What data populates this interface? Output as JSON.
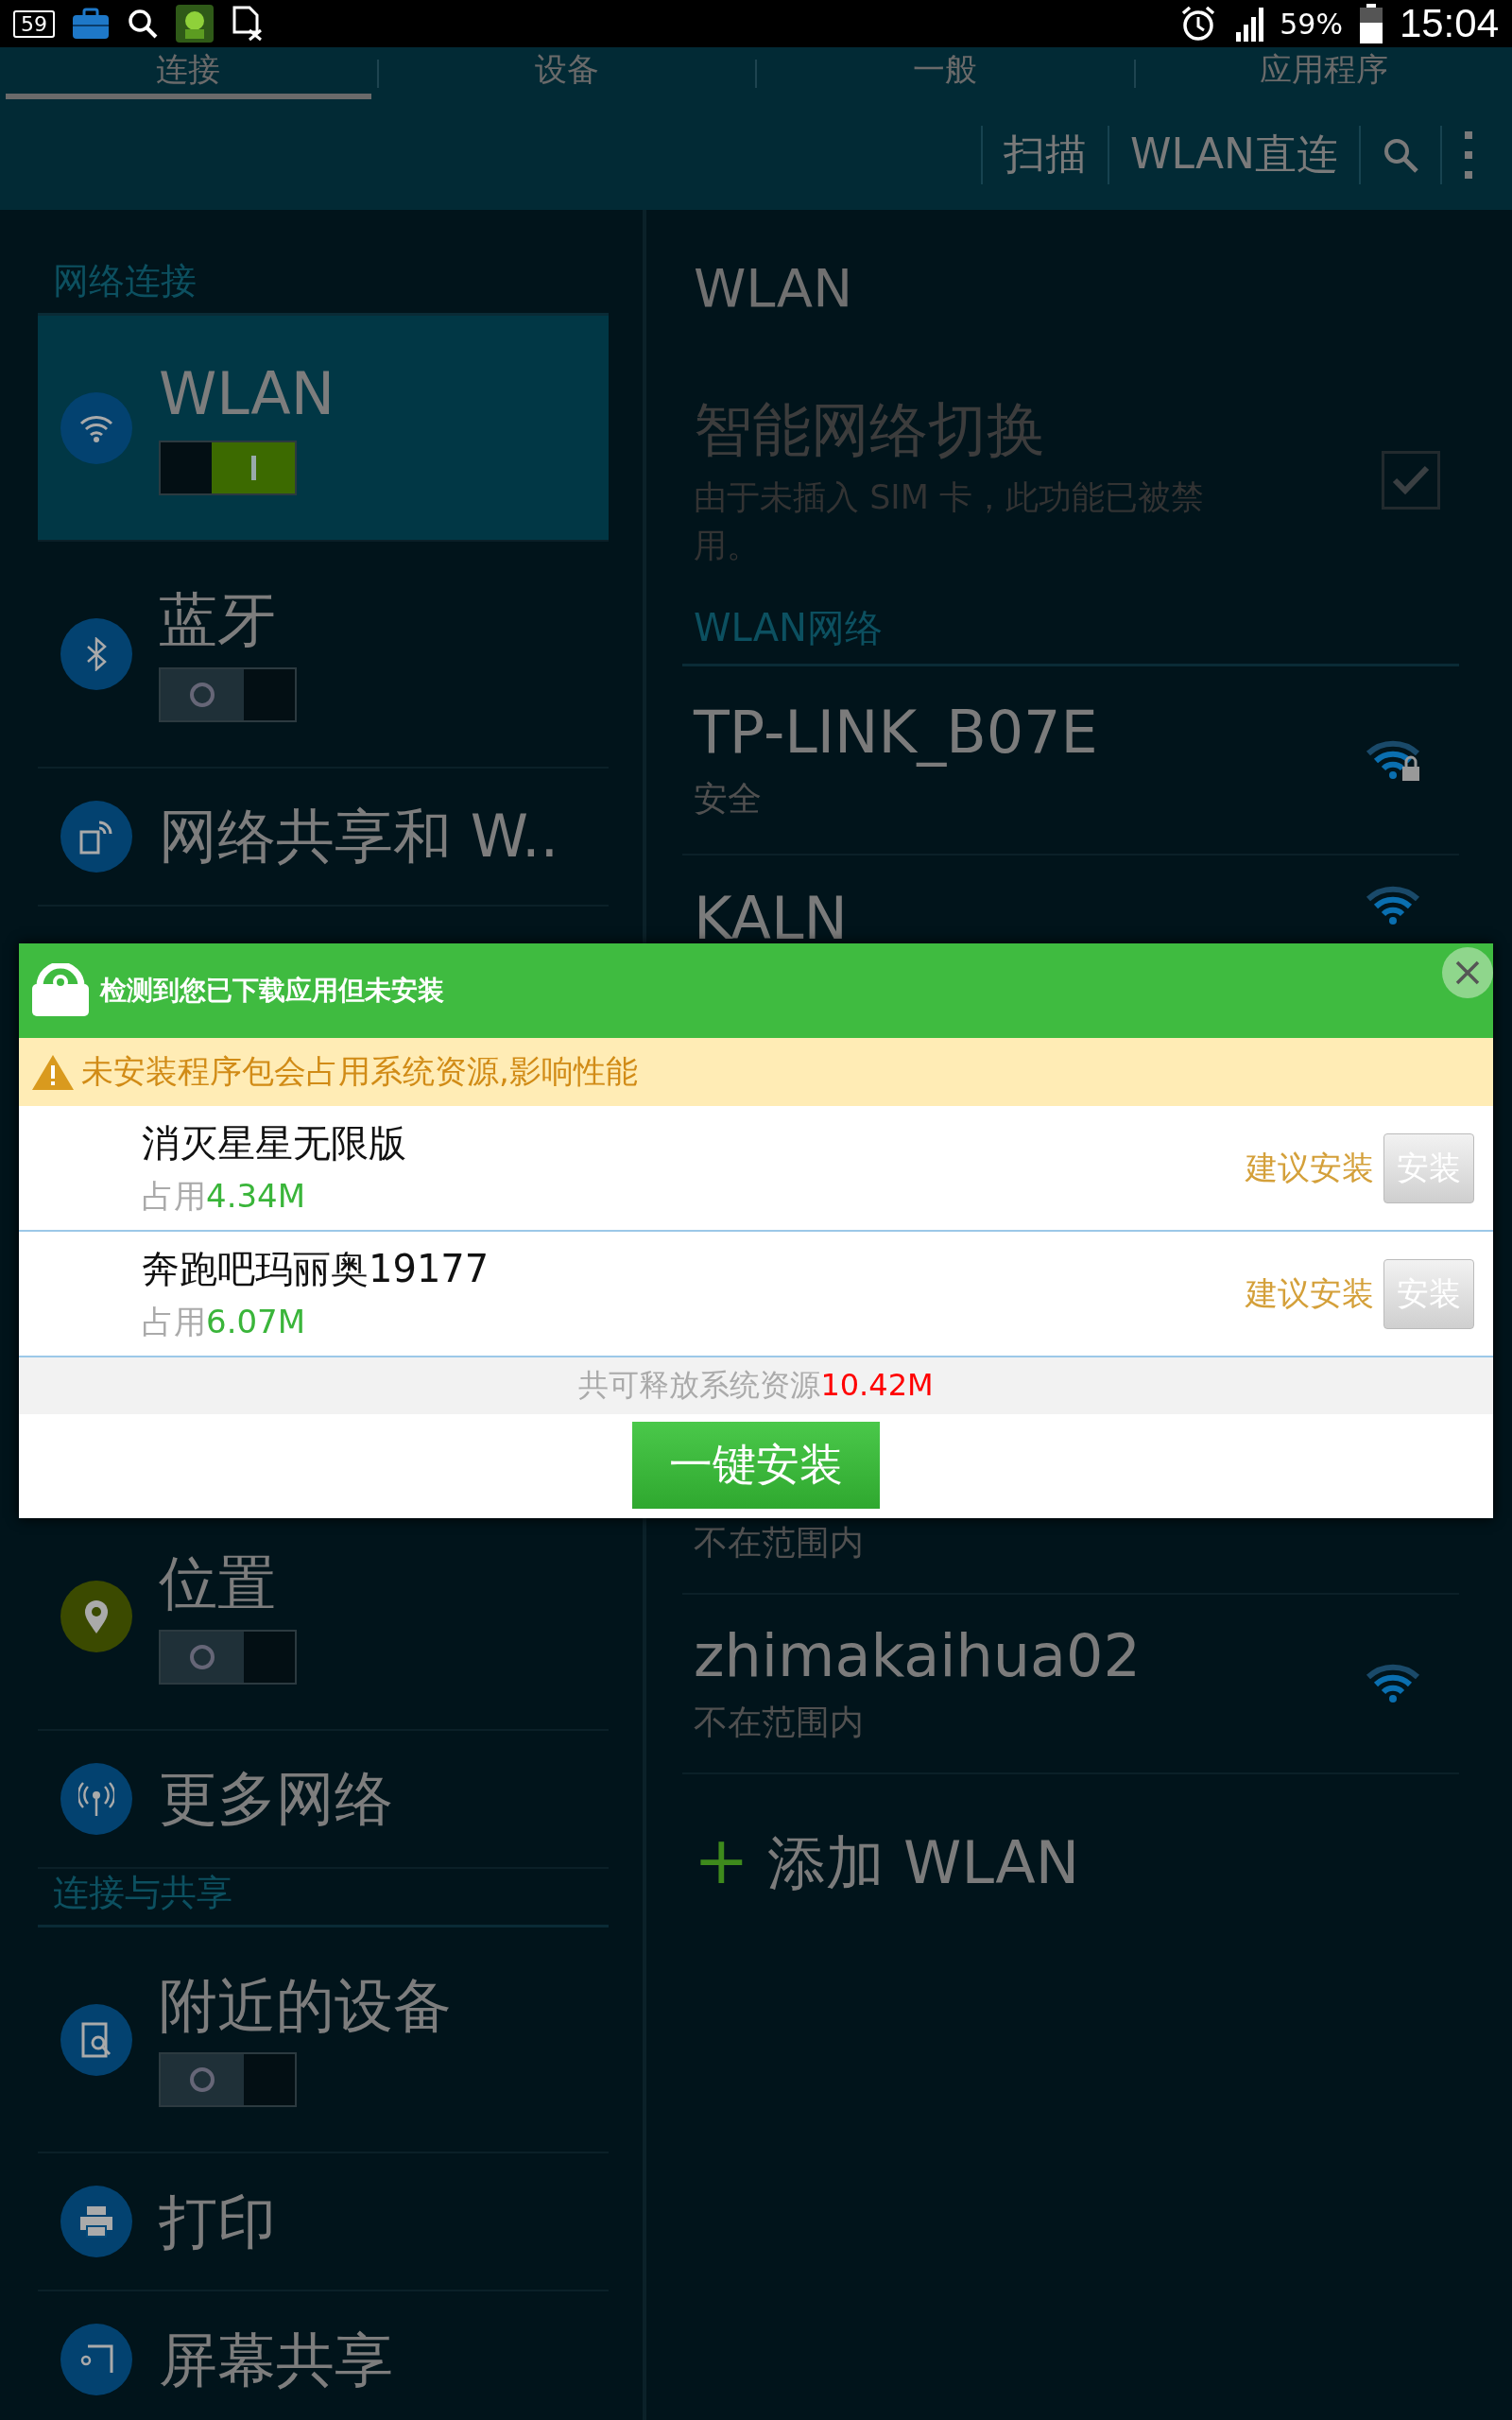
{
  "status_bar": {
    "notification_badge": "59",
    "battery": "59%",
    "time": "15:04"
  },
  "tabs": [
    {
      "label": "连接",
      "selected": true
    },
    {
      "label": "设备",
      "selected": false
    },
    {
      "label": "一般",
      "selected": false
    },
    {
      "label": "应用程序",
      "selected": false
    }
  ],
  "action_bar": {
    "actions": [
      "扫描",
      "WLAN直连"
    ]
  },
  "sidebar": {
    "sections": [
      {
        "header": "网络连接",
        "items": [
          {
            "label": "WLAN",
            "kind": "toggle",
            "on": true,
            "selected": true
          },
          {
            "label": "蓝牙",
            "kind": "toggle",
            "on": false,
            "selected": false
          },
          {
            "label": "网络共享和 W..",
            "kind": "link",
            "selected": false
          }
        ]
      },
      {
        "items": [
          {
            "label": "位置",
            "kind": "toggle",
            "on": false,
            "selected": false
          },
          {
            "label": "更多网络",
            "kind": "link",
            "selected": false
          }
        ]
      },
      {
        "header": "连接与共享",
        "items": [
          {
            "label": "附近的设备",
            "kind": "toggle",
            "on": false,
            "selected": false
          },
          {
            "label": "打印",
            "kind": "link",
            "selected": false
          },
          {
            "label": "屏幕共享",
            "kind": "link",
            "selected": false
          }
        ]
      }
    ]
  },
  "detail": {
    "title": "WLAN",
    "smart_switch": {
      "label": "智能网络切换",
      "description": "由于未插入 SIM 卡，此功能已被禁用。",
      "checked": true,
      "disabled": true
    },
    "networks_header": "WLAN网络",
    "networks": [
      {
        "name": "TP-LINK_B07E",
        "status": "安全",
        "secured": true
      },
      {
        "name": "KALN",
        "secured": false
      },
      {
        "status": "不在范围内"
      },
      {
        "name": "zhimakaihua02",
        "status": "不在范围内",
        "secured": false
      }
    ],
    "add_network": {
      "icon": "+",
      "label": "添加 WLAN"
    }
  },
  "popup": {
    "title": "检测到您已下载应用但未安装",
    "warning": "未安装程序包会占用系统资源,影响性能",
    "apps": [
      {
        "name": "消灭星星无限版",
        "size_label": "占用",
        "size": "4.34M",
        "advice": "建议安装",
        "button": "安装"
      },
      {
        "name": "奔跑吧玛丽奥19177",
        "size_label": "占用",
        "size": "6.07M",
        "advice": "建议安装",
        "button": "安装"
      }
    ],
    "total_label": "共可释放系统资源",
    "total": "10.42M",
    "install_all": "一键安装"
  }
}
